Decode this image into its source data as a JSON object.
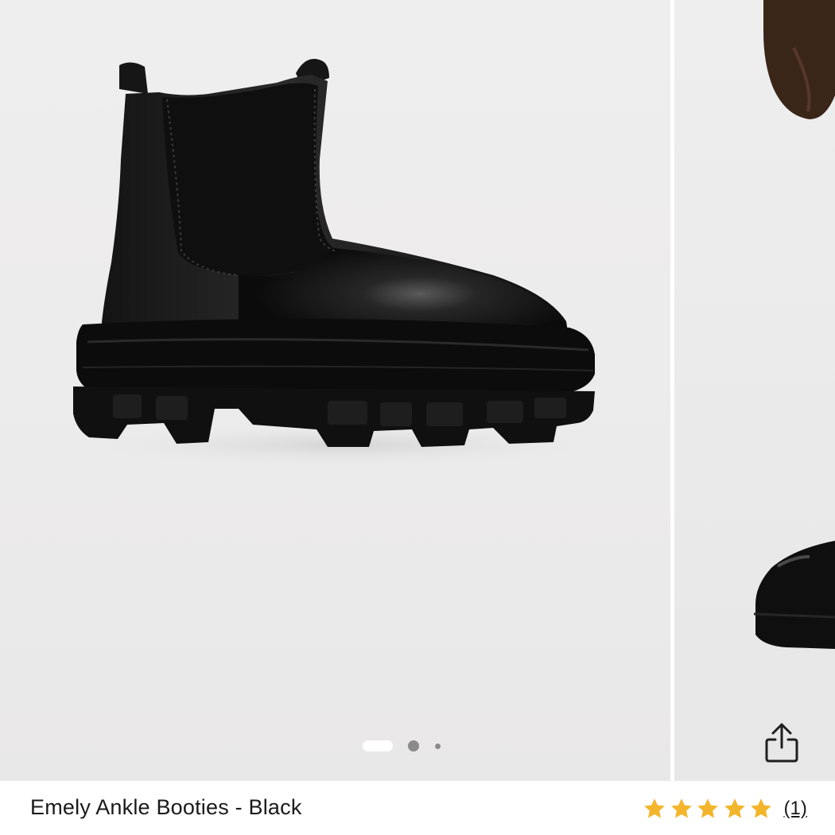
{
  "product": {
    "title": "Emely Ankle Booties - Black",
    "rating": {
      "stars": 5,
      "max": 5,
      "review_count_label": "(1)",
      "star_color": "#f3b52c"
    }
  },
  "gallery": {
    "slides": [
      {
        "image": "black-chelsea-boot-side-view"
      },
      {
        "image": "model-wearing-black-boots"
      }
    ],
    "pager": {
      "count": 3,
      "active_index": 0
    },
    "share_icon": "share-icon"
  }
}
